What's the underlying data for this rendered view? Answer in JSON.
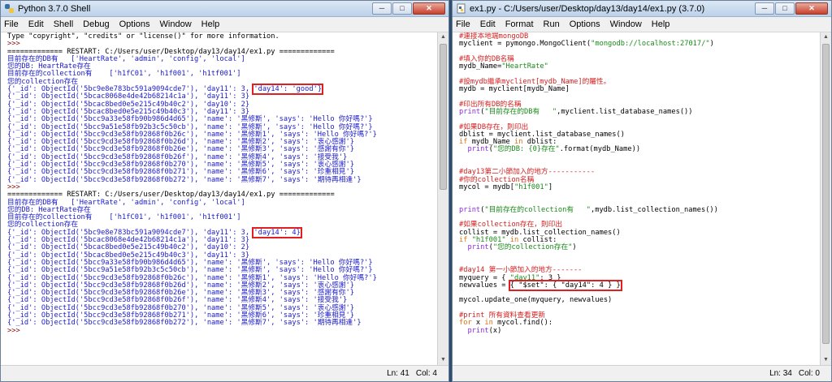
{
  "shell": {
    "title": "Python 3.7.0 Shell",
    "menu": [
      "File",
      "Edit",
      "Shell",
      "Debug",
      "Options",
      "Window",
      "Help"
    ],
    "status": {
      "line": "Ln: 41",
      "col": "Col: 4"
    },
    "lines": [
      {
        "segs": [
          {
            "t": "Type \"copyright\", \"credits\" or \"license()\" for more information.",
            "c": "plain"
          }
        ]
      },
      {
        "segs": [
          {
            "t": ">>> ",
            "c": "prompt"
          }
        ]
      },
      {
        "segs": [
          {
            "t": "============= RESTART: C:/Users/user/Desktop/day13/day14/ex1.py =============",
            "c": "plain"
          }
        ]
      },
      {
        "segs": [
          {
            "t": "目前存在的DB有   ['HeartRate', 'admin', 'config', 'local']",
            "c": "out"
          }
        ]
      },
      {
        "segs": [
          {
            "t": "您的DB: HeartRate存在",
            "c": "out"
          }
        ]
      },
      {
        "segs": [
          {
            "t": "目前存在的collection有    ['h1fC01', 'h1f001', 'h1tf001']",
            "c": "out"
          }
        ]
      },
      {
        "segs": [
          {
            "t": "您的collection存在",
            "c": "out"
          }
        ]
      },
      {
        "segs": [
          {
            "t": "{'_id': ObjectId('5bc9e8e783bc591a9094cde7'), 'day11': 3, ",
            "c": "out"
          },
          {
            "t": "'day14': 'good'}",
            "c": "out",
            "hl": true
          }
        ]
      },
      {
        "segs": [
          {
            "t": "{'_id': ObjectId('5bcac8068e4de42b68214c1a'), 'day11': 3}",
            "c": "out"
          }
        ]
      },
      {
        "segs": [
          {
            "t": "{'_id': ObjectId('5bcac8bed0e5e215c49b40c2'), 'day10': 2}",
            "c": "out"
          }
        ]
      },
      {
        "segs": [
          {
            "t": "{'_id': ObjectId('5bcac8bed0e5e215c49b40c3'), 'day11': 3}",
            "c": "out"
          }
        ]
      },
      {
        "segs": [
          {
            "t": "{'_id': ObjectId('5bcc9a33e58fb90b986d4d65'), 'name': '黑修斯', 'says': 'Hello 你好嗎?'}",
            "c": "out"
          }
        ]
      },
      {
        "segs": [
          {
            "t": "{'_id': ObjectId('5bcc9a51e58fb92b3c5c50cb'), 'name': '黑修斯', 'says': 'Hello 你好嗎?'}",
            "c": "out"
          }
        ]
      },
      {
        "segs": [
          {
            "t": "{'_id': ObjectId('5bcc9cd3e58fb92868f0b26c'), 'name': '黑修斯1', 'says': 'Hello 你好嗎?'}",
            "c": "out"
          }
        ]
      },
      {
        "segs": [
          {
            "t": "{'_id': ObjectId('5bcc9cd3e58fb92868f0b26d'), 'name': '黑修斯2', 'says': '衷心感謝'}",
            "c": "out"
          }
        ]
      },
      {
        "segs": [
          {
            "t": "{'_id': ObjectId('5bcc9cd3e58fb92868f0b26e'), 'name': '黑修斯3', 'says': '感謝有你'}",
            "c": "out"
          }
        ]
      },
      {
        "segs": [
          {
            "t": "{'_id': ObjectId('5bcc9cd3e58fb92868f0b26f'), 'name': '黑修斯4', 'says': '接受我'}",
            "c": "out"
          }
        ]
      },
      {
        "segs": [
          {
            "t": "{'_id': ObjectId('5bcc9cd3e58fb92868f0b270'), 'name': '黑修斯5', 'says': '衷心感謝'}",
            "c": "out"
          }
        ]
      },
      {
        "segs": [
          {
            "t": "{'_id': ObjectId('5bcc9cd3e58fb92868f0b271'), 'name': '黑修斯6', 'says': '珍重相見'}",
            "c": "out"
          }
        ]
      },
      {
        "segs": [
          {
            "t": "{'_id': ObjectId('5bcc9cd3e58fb92868f0b272'), 'name': '黑修斯7', 'says': '期待再相逢'}",
            "c": "out"
          }
        ]
      },
      {
        "segs": [
          {
            "t": ">>> ",
            "c": "prompt"
          }
        ]
      },
      {
        "segs": [
          {
            "t": "============= RESTART: C:/Users/user/Desktop/day13/day14/ex1.py =============",
            "c": "plain"
          }
        ]
      },
      {
        "segs": [
          {
            "t": "目前存在的DB有   ['HeartRate', 'admin', 'config', 'local']",
            "c": "out"
          }
        ]
      },
      {
        "segs": [
          {
            "t": "您的DB: HeartRate存在",
            "c": "out"
          }
        ]
      },
      {
        "segs": [
          {
            "t": "目前存在的collection有    ['h1fC01', 'h1f001', 'h1tf001']",
            "c": "out"
          }
        ]
      },
      {
        "segs": [
          {
            "t": "您的collection存在",
            "c": "out"
          }
        ]
      },
      {
        "segs": [
          {
            "t": "{'_id': ObjectId('5bc9e8e783bc591a9094cde7'), 'day11': 3, ",
            "c": "out"
          },
          {
            "t": "'day14': 4}",
            "c": "out",
            "hl": true
          }
        ]
      },
      {
        "segs": [
          {
            "t": "{'_id': ObjectId('5bcac8068e4de42b68214c1a'), 'day11': 3}",
            "c": "out"
          }
        ]
      },
      {
        "segs": [
          {
            "t": "{'_id': ObjectId('5bcac8bed0e5e215c49b40c2'), 'day10': 2}",
            "c": "out"
          }
        ]
      },
      {
        "segs": [
          {
            "t": "{'_id': ObjectId('5bcac8bed0e5e215c49b40c3'), 'day11': 3}",
            "c": "out"
          }
        ]
      },
      {
        "segs": [
          {
            "t": "{'_id': ObjectId('5bcc9a33e58fb90b986d4d65'), 'name': '黑修斯', 'says': 'Hello 你好嗎?'}",
            "c": "out"
          }
        ]
      },
      {
        "segs": [
          {
            "t": "{'_id': ObjectId('5bcc9a51e58fb92b3c5c50cb'), 'name': '黑修斯', 'says': 'Hello 你好嗎?'}",
            "c": "out"
          }
        ]
      },
      {
        "segs": [
          {
            "t": "{'_id': ObjectId('5bcc9cd3e58fb92868f0b26c'), 'name': '黑修斯1', 'says': 'Hello 你好嗎?'}",
            "c": "out"
          }
        ]
      },
      {
        "segs": [
          {
            "t": "{'_id': ObjectId('5bcc9cd3e58fb92868f0b26d'), 'name': '黑修斯2', 'says': '衷心感謝'}",
            "c": "out"
          }
        ]
      },
      {
        "segs": [
          {
            "t": "{'_id': ObjectId('5bcc9cd3e58fb92868f0b26e'), 'name': '黑修斯3', 'says': '感謝有你'}",
            "c": "out"
          }
        ]
      },
      {
        "segs": [
          {
            "t": "{'_id': ObjectId('5bcc9cd3e58fb92868f0b26f'), 'name': '黑修斯4', 'says': '接受我'}",
            "c": "out"
          }
        ]
      },
      {
        "segs": [
          {
            "t": "{'_id': ObjectId('5bcc9cd3e58fb92868f0b270'), 'name': '黑修斯5', 'says': '衷心感謝'}",
            "c": "out"
          }
        ]
      },
      {
        "segs": [
          {
            "t": "{'_id': ObjectId('5bcc9cd3e58fb92868f0b271'), 'name': '黑修斯6', 'says': '珍重相見'}",
            "c": "out"
          }
        ]
      },
      {
        "segs": [
          {
            "t": "{'_id': ObjectId('5bcc9cd3e58fb92868f0b272'), 'name': '黑修斯7', 'says': '期待再相逢'}",
            "c": "out"
          }
        ]
      },
      {
        "segs": [
          {
            "t": ">>> ",
            "c": "prompt"
          }
        ]
      }
    ]
  },
  "editor": {
    "title": "ex1.py - C:/Users/user/Desktop/day13/day14/ex1.py (3.7.0)",
    "menu": [
      "File",
      "Edit",
      "Format",
      "Run",
      "Options",
      "Window",
      "Help"
    ],
    "status": {
      "line": "Ln: 34",
      "col": "Col: 0"
    },
    "lines": [
      {
        "segs": [
          {
            "t": "#連接本地端mongoDB",
            "c": "cm"
          }
        ]
      },
      {
        "segs": [
          {
            "t": "myclient = pymongo.MongoClient(",
            "c": "plain"
          },
          {
            "t": "\"mongodb://localhost:27017/\"",
            "c": "str"
          },
          {
            "t": ")",
            "c": "plain"
          }
        ]
      },
      {
        "segs": []
      },
      {
        "segs": [
          {
            "t": "#填入你的DB名稱",
            "c": "cm"
          }
        ]
      },
      {
        "segs": [
          {
            "t": "mydb_Name=",
            "c": "plain"
          },
          {
            "t": "\"HeartRate\"",
            "c": "str"
          }
        ]
      },
      {
        "segs": []
      },
      {
        "segs": [
          {
            "t": "#設mydb繼承myclient[mydb_Name]的屬性。",
            "c": "cm"
          }
        ]
      },
      {
        "segs": [
          {
            "t": "mydb = myclient[mydb_Name]",
            "c": "plain"
          }
        ]
      },
      {
        "segs": []
      },
      {
        "segs": [
          {
            "t": "#印出所有DB的名稱",
            "c": "cm"
          }
        ]
      },
      {
        "segs": [
          {
            "t": "print",
            "c": "bi"
          },
          {
            "t": "(",
            "c": "plain"
          },
          {
            "t": "\"目前存在的DB有   \"",
            "c": "str"
          },
          {
            "t": ",myclient.list_database_names())",
            "c": "plain"
          }
        ]
      },
      {
        "segs": []
      },
      {
        "segs": [
          {
            "t": "#如果DB存在，則印出",
            "c": "cm"
          }
        ]
      },
      {
        "segs": [
          {
            "t": "dblist = myclient.list_database_names()",
            "c": "plain"
          }
        ]
      },
      {
        "segs": [
          {
            "t": "if ",
            "c": "kw"
          },
          {
            "t": "mydb_Name ",
            "c": "plain"
          },
          {
            "t": "in ",
            "c": "kw"
          },
          {
            "t": "dblist:",
            "c": "plain"
          }
        ]
      },
      {
        "segs": [
          {
            "t": "  print",
            "c": "bi"
          },
          {
            "t": "(",
            "c": "plain"
          },
          {
            "t": "\"您的DB: {0}存在\"",
            "c": "str"
          },
          {
            "t": ".format(mydb_Name))",
            "c": "plain"
          }
        ]
      },
      {
        "segs": []
      },
      {
        "segs": []
      },
      {
        "segs": [
          {
            "t": "#day13第二小節加入的地方-----------",
            "c": "cm"
          }
        ]
      },
      {
        "segs": [
          {
            "t": "#你的collection名稱",
            "c": "cm"
          }
        ]
      },
      {
        "segs": [
          {
            "t": "mycol = mydb[",
            "c": "plain"
          },
          {
            "t": "\"h1f001\"",
            "c": "str"
          },
          {
            "t": "]",
            "c": "plain"
          }
        ]
      },
      {
        "segs": []
      },
      {
        "segs": []
      },
      {
        "segs": [
          {
            "t": "print",
            "c": "bi"
          },
          {
            "t": "(",
            "c": "plain"
          },
          {
            "t": "\"目前存在的collection有   \"",
            "c": "str"
          },
          {
            "t": ",mydb.list_collection_names())",
            "c": "plain"
          }
        ]
      },
      {
        "segs": []
      },
      {
        "segs": [
          {
            "t": "#如果collection存在，則印出",
            "c": "cm"
          }
        ]
      },
      {
        "segs": [
          {
            "t": "collist = mydb.list_collection_names()",
            "c": "plain"
          }
        ]
      },
      {
        "segs": [
          {
            "t": "if ",
            "c": "kw"
          },
          {
            "t": "\"h1f001\" ",
            "c": "str"
          },
          {
            "t": "in ",
            "c": "kw"
          },
          {
            "t": "collist:",
            "c": "plain"
          }
        ]
      },
      {
        "segs": [
          {
            "t": "  print",
            "c": "bi"
          },
          {
            "t": "(",
            "c": "plain"
          },
          {
            "t": "\"您的collection存在\"",
            "c": "str"
          },
          {
            "t": ")",
            "c": "plain"
          }
        ]
      },
      {
        "segs": []
      },
      {
        "segs": []
      },
      {
        "segs": [
          {
            "t": "#day14 第一小節加入的地方-------",
            "c": "cm"
          }
        ]
      },
      {
        "segs": [
          {
            "t": "myquery = { ",
            "c": "plain"
          },
          {
            "t": "\"day11\"",
            "c": "str"
          },
          {
            "t": ": 3 }",
            "c": "plain"
          }
        ]
      },
      {
        "segs": [
          {
            "t": "newvalues = ",
            "c": "plain"
          },
          {
            "t": "{ \"$set\": { \"day14\": 4 } }",
            "c": "plain",
            "hl": true
          }
        ]
      },
      {
        "segs": []
      },
      {
        "segs": [
          {
            "t": "mycol.update_one(myquery, newvalues)",
            "c": "plain"
          }
        ]
      },
      {
        "segs": []
      },
      {
        "segs": [
          {
            "t": "#print 所有資料查看更新",
            "c": "cm"
          }
        ]
      },
      {
        "segs": [
          {
            "t": "for ",
            "c": "kw"
          },
          {
            "t": "x ",
            "c": "plain"
          },
          {
            "t": "in ",
            "c": "kw"
          },
          {
            "t": "mycol.find():",
            "c": "plain"
          }
        ]
      },
      {
        "segs": [
          {
            "t": "  print",
            "c": "bi"
          },
          {
            "t": "(x)",
            "c": "plain"
          }
        ]
      }
    ]
  }
}
